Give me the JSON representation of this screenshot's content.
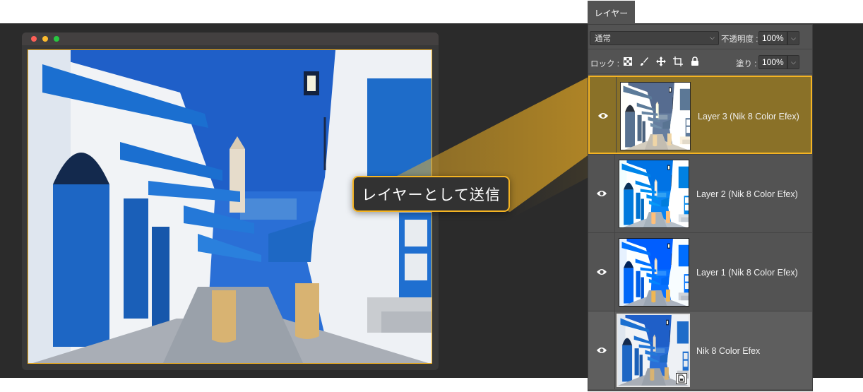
{
  "window": {
    "title": ""
  },
  "callout": {
    "label": "レイヤーとして送信"
  },
  "layers_panel": {
    "tab_label": "レイヤー",
    "blend_mode": "通常",
    "opacity_label": "不透明度 :",
    "opacity_value": "100%",
    "lock_label": "ロック :",
    "lock_icons": [
      "lock-transparent-pixels-icon",
      "lock-image-pixels-icon",
      "lock-position-icon",
      "lock-artboard-icon",
      "lock-all-icon"
    ],
    "fill_label": "塗り :",
    "fill_value": "100%",
    "layers": [
      {
        "name": "Layer 3 (Nik 8 Color Efex)",
        "visible": true,
        "selected": true
      },
      {
        "name": "Layer 2 (Nik 8 Color Efex)",
        "visible": true,
        "selected": false
      },
      {
        "name": "Layer 1 (Nik 8 Color Efex)",
        "visible": true,
        "selected": false
      },
      {
        "name": "Nik 8 Color Efex",
        "visible": true,
        "selected": false,
        "smart_object": true
      }
    ]
  },
  "colors": {
    "accent": "#f5b423",
    "panel": "#535353",
    "backdrop": "#2b2b2b"
  }
}
